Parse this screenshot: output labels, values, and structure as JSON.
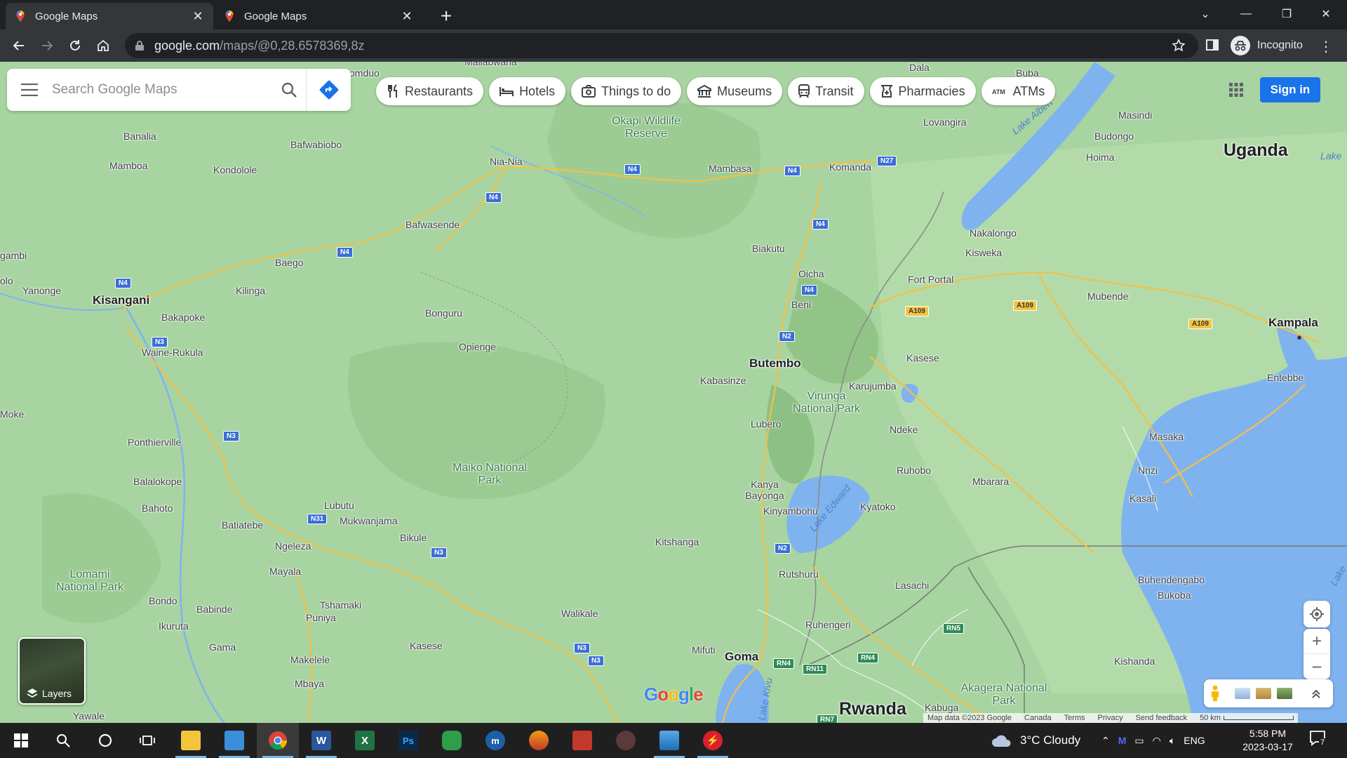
{
  "browser": {
    "tabs": [
      {
        "title": "Google Maps",
        "active": true
      },
      {
        "title": "Google Maps",
        "active": false
      }
    ],
    "url_host": "google.com",
    "url_path": "/maps/@0,28.6578369,8z",
    "profile_label": "Incognito"
  },
  "maps": {
    "search_placeholder": "Search Google Maps",
    "chips": [
      "Restaurants",
      "Hotels",
      "Things to do",
      "Museums",
      "Transit",
      "Pharmacies",
      "ATMs"
    ],
    "sign_in": "Sign in",
    "layers_label": "Layers",
    "logo": "Google",
    "attribution": {
      "map_data": "Map data ©2023 Google",
      "country": "Canada",
      "terms": "Terms",
      "privacy": "Privacy",
      "feedback": "Send feedback",
      "scale": "50 km"
    },
    "places": {
      "uganda": "Uganda",
      "rwanda": "Rwanda",
      "kampala": "Kampala",
      "kisangani": "Kisangani",
      "butembo": "Butembo",
      "goma": "Goma",
      "malia": "Maliabwana",
      "omduo": "omduo",
      "dala": "Dala",
      "buba": "Buba",
      "okapi": "Okapi Wildlife Reserve",
      "banalia": "Banalia",
      "bafwabiobo": "Bafwabiobo",
      "niania": "Nia-Nia",
      "mambasa": "Mambasa",
      "komanda": "Komanda",
      "lovangira": "Lovangira",
      "masindi": "Masindi",
      "budongo": "Budongo",
      "hoima": "Hoima",
      "lakealbert": "Lake Albert",
      "lakeuganda": "Lake",
      "mamboa": "Mamboa",
      "kondolole": "Kondolole",
      "bafwasende": "Bafwasende",
      "nakalongo": "Nakalongo",
      "kisweka": "Kisweka",
      "biakutu": "Biakutu",
      "gambi": "gambi",
      "baego": "Baego",
      "oicha": "Oicha",
      "fortportal": "Fort Portal",
      "mubende": "Mubende",
      "olo": "olo",
      "yanonge": "Yanonge",
      "kilinga": "Kilinga",
      "beni": "Beni",
      "bakapoke": "Bakapoke",
      "bonguru": "Bonguru",
      "wainerukula": "Waine-Rukula",
      "opienge": "Opienge",
      "kasese": "Kasese",
      "entebbe": "Entebbe",
      "kabasinze": "Kabasinze",
      "karujumba": "Karujumba",
      "virunga": "Virunga National Park",
      "lubero": "Lubero",
      "moke": "Moke",
      "ndeke": "Ndeke",
      "ponthierville": "Ponthierville",
      "masaka": "Masaka",
      "lakeedward": "Lake Edward",
      "maiko": "Maiko National Park",
      "ruhobo": "Ruhobo",
      "nnzi": "Nnzi",
      "balalokope": "Balalokope",
      "mbarara": "Mbarara",
      "kanya": "Kanya Bayonga",
      "kasali": "Kasali",
      "bahoto": "Bahoto",
      "lubutu": "Lubutu",
      "kyatoko": "Kyatoko",
      "kinyambohu": "Kinyambohu",
      "batiatebe": "Batiatebe",
      "mukwanjama": "Mukwanjama",
      "bikule": "Bikule",
      "kitshanga": "Kitshanga",
      "ngeleza": "Ngeleza",
      "lomami": "Lomami National Park",
      "mayala": "Mayala",
      "rutshuru": "Rutshuru",
      "buhendengabo": "Buhendengabo",
      "lasachi": "Lasachi",
      "bukoba": "Bukoba",
      "bondo": "Bondo",
      "tshamaki": "Tshamaki",
      "babinde": "Babinde",
      "walikale": "Walikale",
      "puniya": "Puniya",
      "ruhengeri": "Ruhengeri",
      "ikuruta": "Ikuruta",
      "kasese2": "Kasese",
      "gama": "Gama",
      "mifuti": "Mifuti",
      "makelele": "Makelele",
      "kishanda": "Kishanda",
      "mbaya": "Mbaya",
      "akagera": "Akagera National Park",
      "yawale": "Yawale",
      "lakekivu": "Lake Kivu",
      "kabuga": "Kabuga",
      "lakevic": "Lake"
    },
    "shields": {
      "n4a": "N4",
      "n4b": "N4",
      "n4c": "N4",
      "n4d": "N4",
      "n4e": "N4",
      "n4f": "N4",
      "n4g": "N4",
      "n27": "N27",
      "n3a": "N3",
      "n3b": "N3",
      "n3c": "N3",
      "n3d": "N3",
      "n3e": "N3",
      "n2a": "N2",
      "n2b": "N2",
      "n31": "N31",
      "a109a": "A109",
      "a109b": "A109",
      "a109c": "A109",
      "rn5": "RN5",
      "rn4a": "RN4",
      "rn4b": "RN4",
      "rn11": "RN11",
      "rn7": "RN7"
    }
  },
  "taskbar": {
    "weather": "3°C  Cloudy",
    "lang": "ENG",
    "time": "5:58 PM",
    "date": "2023-03-17",
    "notif_count": "7"
  }
}
